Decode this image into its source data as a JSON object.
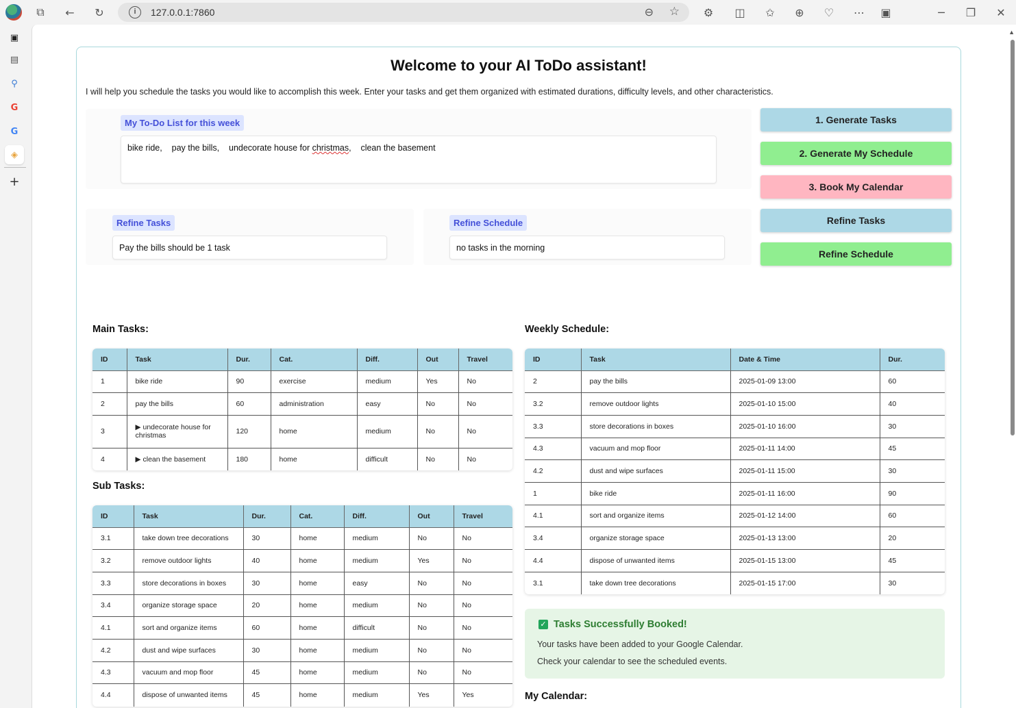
{
  "browser": {
    "url": "127.0.0.1:7860"
  },
  "app": {
    "title": "Welcome to your AI ToDo assistant!",
    "intro": "I will help you schedule the tasks you would like to accomplish this week. Enter your tasks and get them organized with estimated durations, difficulty levels, and other characteristics.",
    "todo_label": "My To-Do List for this week",
    "todo_parts": [
      "bike ride,    pay the bills,    undecorate house for ",
      "christmas",
      ",    clean the basement"
    ],
    "refine_tasks_label": "Refine Tasks",
    "refine_tasks_value": "Pay the bills should be 1 task",
    "refine_schedule_label": "Refine Schedule",
    "refine_schedule_value": "no tasks in the morning",
    "buttons": {
      "generate_tasks": "1. Generate Tasks",
      "generate_schedule": "2. Generate My Schedule",
      "book_calendar": "3. Book My Calendar",
      "refine_tasks": "Refine Tasks",
      "refine_schedule": "Refine Schedule"
    },
    "colors": {
      "blue_button": "#add8e6",
      "green_button": "#90ee90",
      "pink_button": "#ffb6c1"
    }
  },
  "main_tasks": {
    "title": "Main Tasks:",
    "headers": [
      "ID",
      "Task",
      "Dur.",
      "Cat.",
      "Diff.",
      "Out",
      "Travel"
    ],
    "rows": [
      [
        "1",
        "bike ride",
        "90",
        "exercise",
        "medium",
        "Yes",
        "No"
      ],
      [
        "2",
        "pay the bills",
        "60",
        "administration",
        "easy",
        "No",
        "No"
      ],
      [
        "3",
        "▶ undecorate house for christmas",
        "120",
        "home",
        "medium",
        "No",
        "No"
      ],
      [
        "4",
        "▶ clean the basement",
        "180",
        "home",
        "difficult",
        "No",
        "No"
      ]
    ]
  },
  "sub_tasks": {
    "title": "Sub Tasks:",
    "headers": [
      "ID",
      "Task",
      "Dur.",
      "Cat.",
      "Diff.",
      "Out",
      "Travel"
    ],
    "rows": [
      [
        "3.1",
        "take down tree decorations",
        "30",
        "home",
        "medium",
        "No",
        "No"
      ],
      [
        "3.2",
        "remove outdoor lights",
        "40",
        "home",
        "medium",
        "Yes",
        "No"
      ],
      [
        "3.3",
        "store decorations in boxes",
        "30",
        "home",
        "easy",
        "No",
        "No"
      ],
      [
        "3.4",
        "organize storage space",
        "20",
        "home",
        "medium",
        "No",
        "No"
      ],
      [
        "4.1",
        "sort and organize items",
        "60",
        "home",
        "difficult",
        "No",
        "No"
      ],
      [
        "4.2",
        "dust and wipe surfaces",
        "30",
        "home",
        "medium",
        "No",
        "No"
      ],
      [
        "4.3",
        "vacuum and mop floor",
        "45",
        "home",
        "medium",
        "No",
        "No"
      ],
      [
        "4.4",
        "dispose of unwanted items",
        "45",
        "home",
        "medium",
        "Yes",
        "Yes"
      ]
    ]
  },
  "weekly_schedule": {
    "title": "Weekly Schedule:",
    "headers": [
      "ID",
      "Task",
      "Date & Time",
      "Dur."
    ],
    "rows": [
      [
        "2",
        "pay the bills",
        "2025-01-09 13:00",
        "60"
      ],
      [
        "3.2",
        "remove outdoor lights",
        "2025-01-10 15:00",
        "40"
      ],
      [
        "3.3",
        "store decorations in boxes",
        "2025-01-10 16:00",
        "30"
      ],
      [
        "4.3",
        "vacuum and mop floor",
        "2025-01-11 14:00",
        "45"
      ],
      [
        "4.2",
        "dust and wipe surfaces",
        "2025-01-11 15:00",
        "30"
      ],
      [
        "1",
        "bike ride",
        "2025-01-11 16:00",
        "90"
      ],
      [
        "4.1",
        "sort and organize items",
        "2025-01-12 14:00",
        "60"
      ],
      [
        "3.4",
        "organize storage space",
        "2025-01-13 13:00",
        "20"
      ],
      [
        "4.4",
        "dispose of unwanted items",
        "2025-01-15 13:00",
        "45"
      ],
      [
        "3.1",
        "take down tree decorations",
        "2025-01-15 17:00",
        "30"
      ]
    ]
  },
  "success": {
    "title": "Tasks Successfully Booked!",
    "line1": "Your tasks have been added to your Google Calendar.",
    "line2": "Check your calendar to see the scheduled events."
  },
  "calendar_title": "My Calendar:"
}
